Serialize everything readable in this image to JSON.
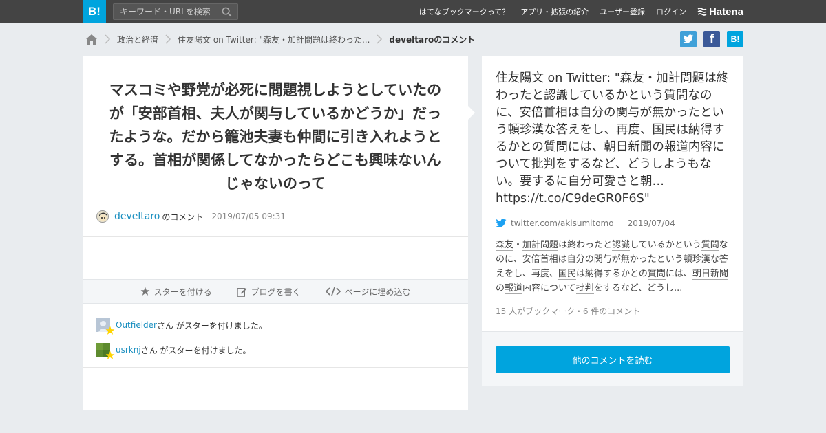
{
  "header": {
    "logo": "B!",
    "search_placeholder": "キーワード・URLを検索",
    "nav": [
      "はてなブックマークって？",
      "アプリ・拡張の紹介",
      "ユーザー登録",
      "ログイン"
    ],
    "brand": "Hatena"
  },
  "breadcrumb": {
    "items": [
      "政治と経済",
      "住友陽文 on Twitter: \"森友・加計問題は終わった...",
      "develtaroのコメント"
    ]
  },
  "share": {
    "facebook": "f",
    "hatena": "B!"
  },
  "comment": {
    "text": "マスコミや野党が必死に問題視しようとしていたのが「安部首相、夫人が関与しているかどうか」だったような。だから籠池夫妻も仲間に引き入れようとする。首相が関係してなかったらどこも興味ないんじゃないのって",
    "user": "develtaro",
    "suffix": "のコメント",
    "date": "2019/07/05 09:31"
  },
  "actions": {
    "star": "スターを付ける",
    "blog": "ブログを書く",
    "embed": "ページに埋め込む"
  },
  "stars": [
    {
      "user": "Outfielder",
      "text": "さん がスターを付けました。"
    },
    {
      "user": "usrknj",
      "text": "さん がスターを付けました。"
    }
  ],
  "entry": {
    "title": "住友陽文 on Twitter: \"森友・加計問題は終わったと認識しているかという質問なのに、安倍首相は自分の関与が無かったという頓珍漢な答えをし、再度、国民は納得するかとの質問には、朝日新聞の報道内容について批判をするなど、どうしようもない。要するに自分可愛さと朝… https://t.co/C9deGR0F6S\"",
    "source": "twitter.com/akisumitomo",
    "date": "2019/07/04",
    "summary": {
      "s1": "森友",
      "s2": "・",
      "s3": "加計",
      "s4": "問題",
      "s5": "は終わったと",
      "s6": "認識",
      "s7": "しているかという",
      "s8": "質問",
      "s9": "なのに、",
      "s10": "安倍",
      "s11": "首相",
      "s12": "は",
      "s13": "自分",
      "s14": "の関与が無かったという",
      "s15": "頓珍漢",
      "s16": "な答えをし、再度、",
      "s17": "国民",
      "s18": "は納得するかとの",
      "s19": "質問",
      "s20": "には、",
      "s21": "朝日新聞",
      "s22": "の",
      "s23": "報道",
      "s24": "内容について",
      "s25": "批判",
      "s26": "をするなど、どうし..."
    },
    "counts": "15 人がブックマーク・6 件のコメント",
    "more_button": "他のコメントを読む"
  },
  "colors": {
    "accent": "#00a4de",
    "header_bg": "#444444",
    "page_bg": "#e9ecef",
    "link": "#1a8fc0",
    "star": "#ffd400"
  }
}
